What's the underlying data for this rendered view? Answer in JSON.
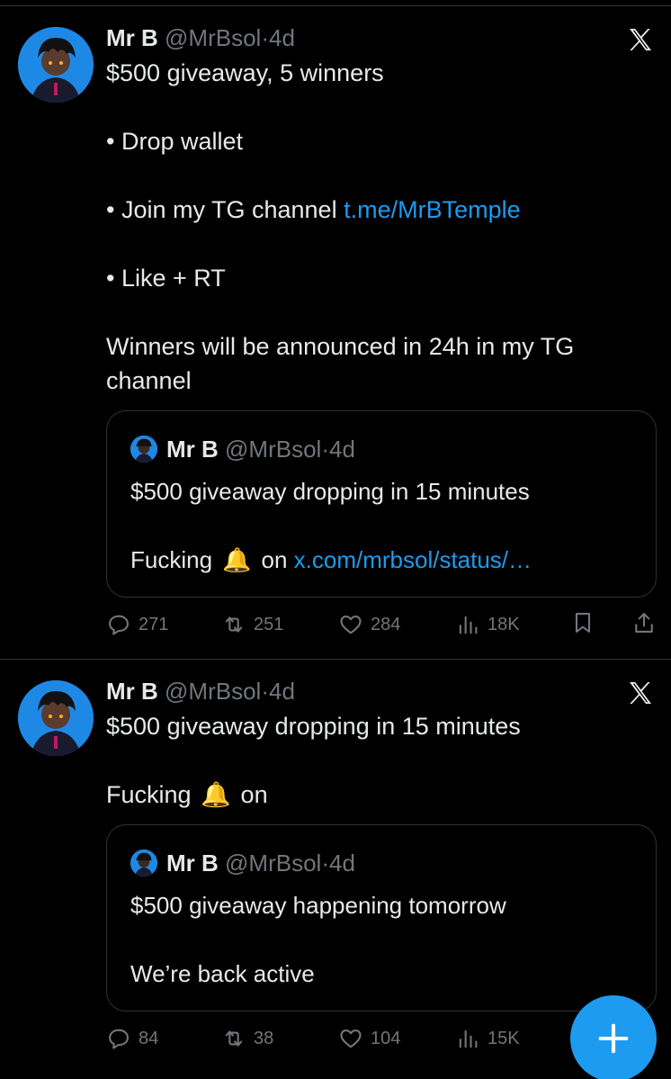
{
  "tweets": [
    {
      "name": "Mr B",
      "handle": "@MrBsol",
      "dot": "·",
      "time": "4d",
      "lines": {
        "l1": "$500 giveaway, 5 winners",
        "l2": "• Drop wallet",
        "l3_prefix": "• Join my TG channel ",
        "l3_link": "t.me/MrBTemple",
        "l4": "• Like + RT",
        "l5": "Winners will be announced in 24h in my TG channel"
      },
      "quote": {
        "name": "Mr B",
        "handle": "@MrBsol",
        "dot": "·",
        "time": "4d",
        "line1": "$500 giveaway dropping in 15 minutes",
        "line2_prefix": "Fucking ",
        "line2_emoji": "🔔",
        "line2_suffix": " on ",
        "line2_link": "x.com/mrbsol/status/…"
      },
      "stats": {
        "replies": "271",
        "reposts": "251",
        "likes": "284",
        "views": "18K"
      }
    },
    {
      "name": "Mr B",
      "handle": "@MrBsol",
      "dot": "·",
      "time": "4d",
      "lines": {
        "l1": "$500 giveaway dropping in 15 minutes",
        "l2_prefix": "Fucking ",
        "l2_emoji": "🔔",
        "l2_suffix": " on"
      },
      "quote": {
        "name": "Mr B",
        "handle": "@MrBsol",
        "dot": "·",
        "time": "4d",
        "line1": "$500 giveaway happening tomorrow",
        "line2": "We’re back active"
      },
      "stats": {
        "replies": "84",
        "reposts": "38",
        "likes": "104",
        "views": "15K"
      }
    }
  ],
  "colors": {
    "accent": "#1d9bf0",
    "muted": "#71767b",
    "text": "#e7e9ea",
    "border": "#2f3336"
  },
  "icons": [
    "x-logo-icon",
    "reply-icon",
    "repost-icon",
    "like-icon",
    "views-icon",
    "bookmark-icon",
    "share-icon",
    "plus-icon"
  ]
}
